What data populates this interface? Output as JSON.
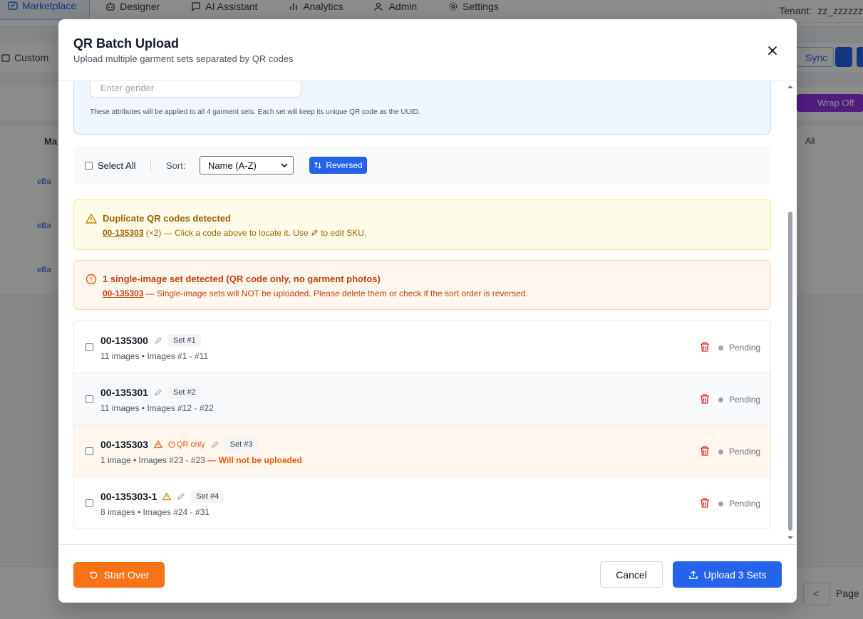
{
  "nav": {
    "items": [
      {
        "label": "Marketplace",
        "icon": "storefront-icon"
      },
      {
        "label": "Designer",
        "icon": "robot-icon"
      },
      {
        "label": "AI Assistant",
        "icon": "chat-icon"
      },
      {
        "label": "Analytics",
        "icon": "bar-chart-icon"
      },
      {
        "label": "Admin",
        "icon": "users-icon"
      },
      {
        "label": "Settings",
        "icon": "gear-icon"
      }
    ],
    "tenant_label": "Tenant:",
    "tenant_value": "zz_zzzzzz"
  },
  "background": {
    "date_range_label": "Custom",
    "sync_label": "Sync",
    "wrap_label": "Wrap Off",
    "col_marketplace": "Ma",
    "filter_all": "All",
    "row_tag": "eBa",
    "page_label": "Page",
    "prev": "<"
  },
  "modal": {
    "title": "QR Batch Upload",
    "subtitle": "Upload multiple garment sets separated by QR codes",
    "gender_placeholder": "Enter gender",
    "attr_note": "These attributes will be applied to all 4 garment sets. Each set will keep its unique QR code as the UUID.",
    "select_all": "Select All",
    "sort_label": "Sort:",
    "sort_value": "Name (A-Z)",
    "reversed_label": "Reversed",
    "dup_alert": {
      "title": "Duplicate QR codes detected",
      "code": "00-135303",
      "count": "(×2)",
      "text_before": "— Click a code above to locate it. Use",
      "text_after": "to edit SKU."
    },
    "single_alert": {
      "title": "1 single-image set detected (QR code only, no garment photos)",
      "code": "00-135303",
      "text": "— Single-image sets will NOT be uploaded. Please delete them or check if the sort order is reversed."
    },
    "sets": [
      {
        "code": "00-135300",
        "badge": "Set #1",
        "meta": "11 images • Images #1 - #11",
        "status": "Pending",
        "warn": false,
        "qr_only": "",
        "note": ""
      },
      {
        "code": "00-135301",
        "badge": "Set #2",
        "meta": "11 images • Images #12 - #22",
        "status": "Pending",
        "warn": false,
        "qr_only": "",
        "note": ""
      },
      {
        "code": "00-135303",
        "badge": "Set #3",
        "meta": "1 image • Images #23 - #23",
        "status": "Pending",
        "warn": true,
        "qr_only": "QR only",
        "note": "— Will not be uploaded"
      },
      {
        "code": "00-135303-1",
        "badge": "Set #4",
        "meta": "8 images • Images #24 - #31",
        "status": "Pending",
        "warn": true,
        "qr_only": "",
        "note": ""
      }
    ],
    "start_over": "Start Over",
    "cancel": "Cancel",
    "upload": "Upload 3 Sets"
  },
  "colors": {
    "primary": "#2563eb",
    "orange": "#f97316",
    "warning_bg": "#fefce8",
    "error_bg": "#fff7ed"
  }
}
